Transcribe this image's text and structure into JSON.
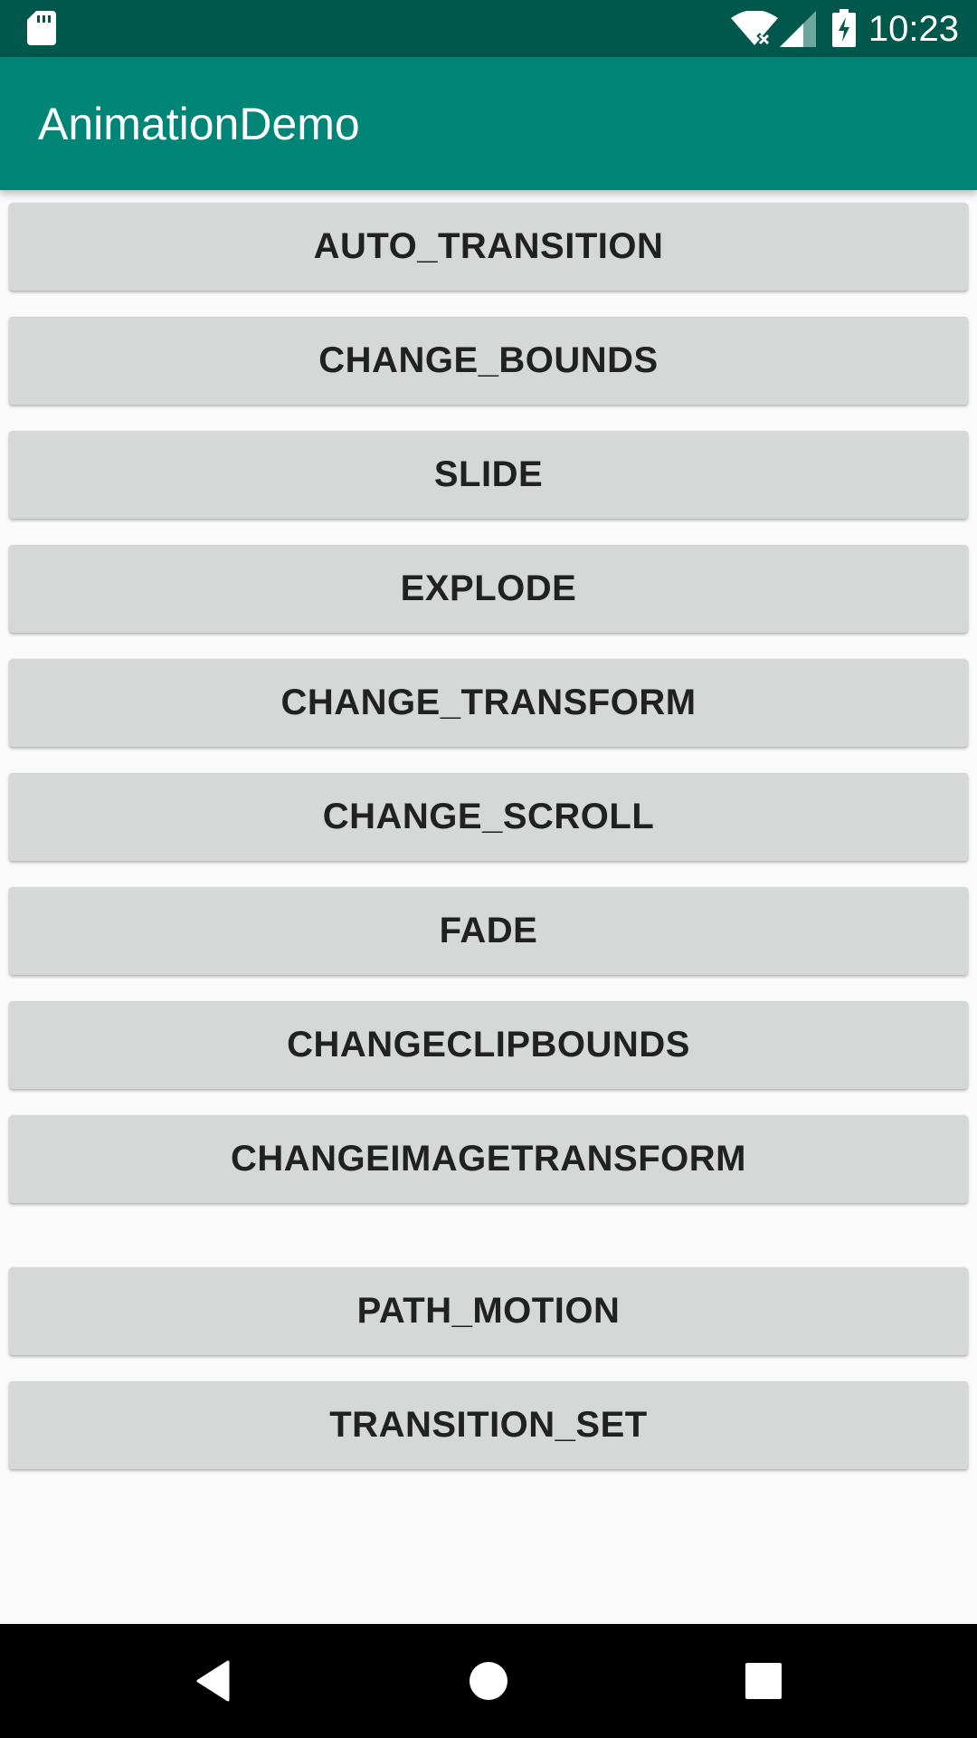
{
  "status_bar": {
    "time": "10:23",
    "icons": [
      "sd-card-icon",
      "wifi-icon",
      "signal-icon",
      "battery-charging-icon"
    ]
  },
  "app_bar": {
    "title": "AnimationDemo"
  },
  "buttons": [
    "AUTO_TRANSITION",
    "CHANGE_BOUNDS",
    "SLIDE",
    "EXPLODE",
    "CHANGE_TRANSFORM",
    "CHANGE_SCROLL",
    "FADE",
    "CHANGECLIPBOUNDS",
    "CHANGEIMAGETRANSFORM",
    "PATH_MOTION",
    "TRANSITION_SET"
  ],
  "nav_bar": {
    "icons": [
      "back-icon",
      "home-icon",
      "recents-icon"
    ]
  },
  "colors": {
    "status_bar": "#00574b",
    "app_bar": "#008577",
    "button_bg": "#d6d7d7",
    "background": "#fafafa"
  }
}
